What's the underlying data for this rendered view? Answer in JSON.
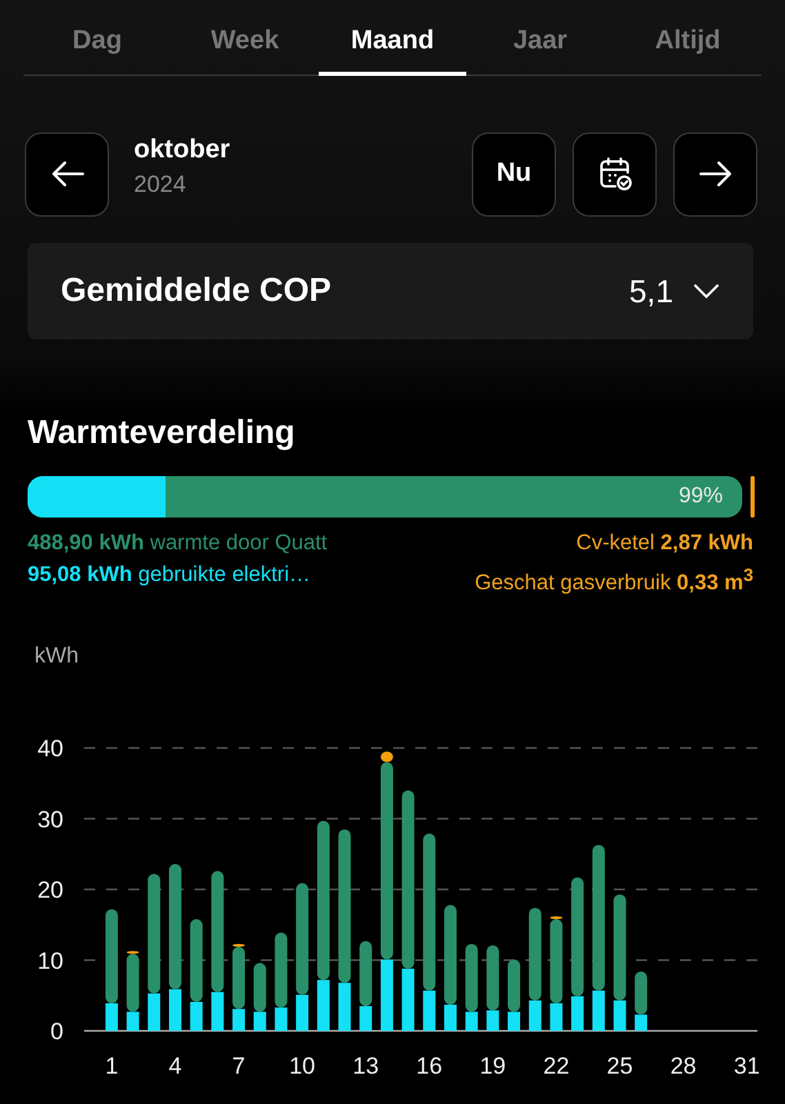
{
  "tabs": [
    {
      "label": "Dag",
      "selected": false
    },
    {
      "label": "Week",
      "selected": false
    },
    {
      "label": "Maand",
      "selected": true
    },
    {
      "label": "Jaar",
      "selected": false
    },
    {
      "label": "Altijd",
      "selected": false
    }
  ],
  "period": {
    "month": "oktober",
    "year": "2024",
    "now_button": "Nu"
  },
  "cop": {
    "label": "Gemiddelde COP",
    "value": "5,1",
    "expanded": false
  },
  "heat": {
    "title": "Warmteverdeling",
    "bar": {
      "percent_label": "99%",
      "level": 0.194,
      "boiler_marker": true
    },
    "legend_left": [
      {
        "kind": "quatt",
        "text": "**488,90 kWh** warmte door Quatt"
      },
      {
        "kind": "electric",
        "text": "**95,08 kWh** gebruikte elektri…"
      }
    ],
    "legend_right": [
      {
        "kind": "boiler",
        "text": "Cv-ketel **2,87 kWh**"
      },
      {
        "kind": "boiler",
        "text": "Geschat gasverbruik **0,33 m$^{3}$**"
      }
    ]
  },
  "chart_data": {
    "type": "bar",
    "ylabel": "kWh",
    "stacked": true,
    "grid": true,
    "ylim": [
      0,
      40
    ],
    "yticks": [
      0,
      10,
      20,
      30,
      40
    ],
    "xlim": [
      -0.3,
      31.5
    ],
    "x": [
      1,
      2,
      3,
      4,
      5,
      6,
      7,
      8,
      9,
      10,
      11,
      12,
      13,
      14,
      15,
      16,
      17,
      18,
      19,
      20,
      21,
      22,
      23,
      24,
      25,
      26
    ],
    "xticks": [
      1,
      4,
      7,
      10,
      13,
      16,
      19,
      22,
      25,
      28,
      31
    ],
    "series": [
      {
        "color": "#13e0f5",
        "values": [
          3.9,
          2.7,
          5.3,
          5.9,
          4.1,
          5.5,
          3.1,
          2.7,
          3.3,
          5.1,
          7.2,
          6.8,
          3.5,
          10.1,
          8.8,
          5.7,
          3.7,
          2.7,
          2.9,
          2.7,
          4.3,
          3.9,
          4.9,
          5.7,
          4.3,
          2.3
        ]
      },
      {
        "color": "#2a906a",
        "values": [
          13.3,
          8.2,
          16.9,
          17.7,
          11.7,
          17.1,
          8.8,
          6.9,
          10.6,
          15.8,
          22.5,
          21.7,
          9.2,
          27.9,
          25.2,
          22.2,
          14.1,
          9.6,
          9.2,
          7.4,
          13.1,
          11.9,
          16.8,
          20.6,
          15.0,
          6.1
        ]
      },
      {
        "color": "#f59e0b",
        "values": [
          0,
          0.3,
          0,
          0,
          0,
          0,
          0.3,
          0,
          0,
          0,
          0,
          0,
          0,
          1.5,
          0,
          0,
          0,
          0,
          0,
          0,
          0,
          0.4,
          0,
          0,
          0,
          0
        ]
      }
    ]
  }
}
